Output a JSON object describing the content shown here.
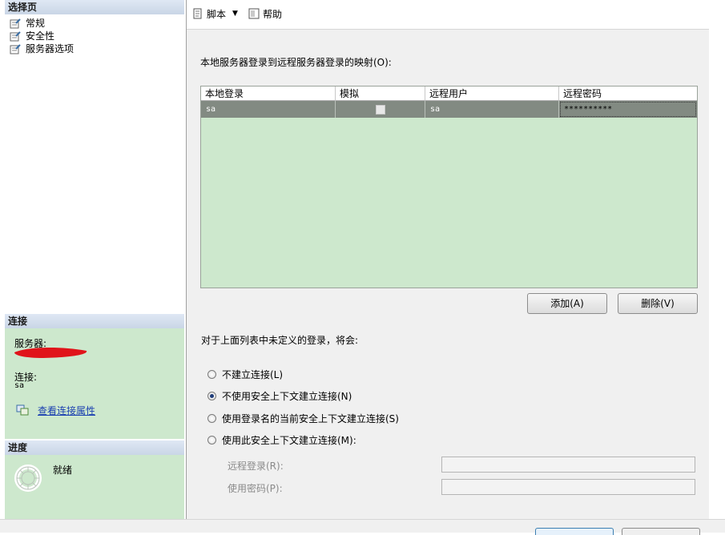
{
  "left": {
    "select_page_header": "选择页",
    "nav_items": [
      {
        "label": "常规"
      },
      {
        "label": "安全性"
      },
      {
        "label": "服务器选项"
      }
    ],
    "connection_header": "连接",
    "server_label": "服务器:",
    "connection_label": "连接:",
    "connection_value": "sa",
    "view_connection_props": "查看连接属性",
    "progress_header": "进度",
    "progress_status": "就绪"
  },
  "toolbar": {
    "script_label": "脚本",
    "help_label": "帮助"
  },
  "main": {
    "mapping_label": "本地服务器登录到远程服务器登录的映射(O):",
    "table": {
      "columns": [
        "本地登录",
        "模拟",
        "远程用户",
        "远程密码"
      ],
      "rows": [
        {
          "local_login": "sa",
          "impersonate": false,
          "remote_user": "sa",
          "remote_password": "**********"
        }
      ]
    },
    "add_button": "添加(A)",
    "remove_button": "删除(V)",
    "undefined_logins_label": "对于上面列表中未定义的登录，将会:",
    "radio_options": [
      {
        "label": "不建立连接(L)",
        "checked": false
      },
      {
        "label": "不使用安全上下文建立连接(N)",
        "checked": true
      },
      {
        "label": "使用登录名的当前安全上下文建立连接(S)",
        "checked": false
      },
      {
        "label": "使用此安全上下文建立连接(M):",
        "checked": false
      }
    ],
    "remote_login_label": "远程登录(R):",
    "remote_login_value": "",
    "password_label": "使用密码(P):",
    "password_value": ""
  },
  "colors": {
    "panel_green": "#cde8cd",
    "selected_row": "#828a82",
    "redaction": "#e0141a",
    "link": "#1a3fb0"
  }
}
